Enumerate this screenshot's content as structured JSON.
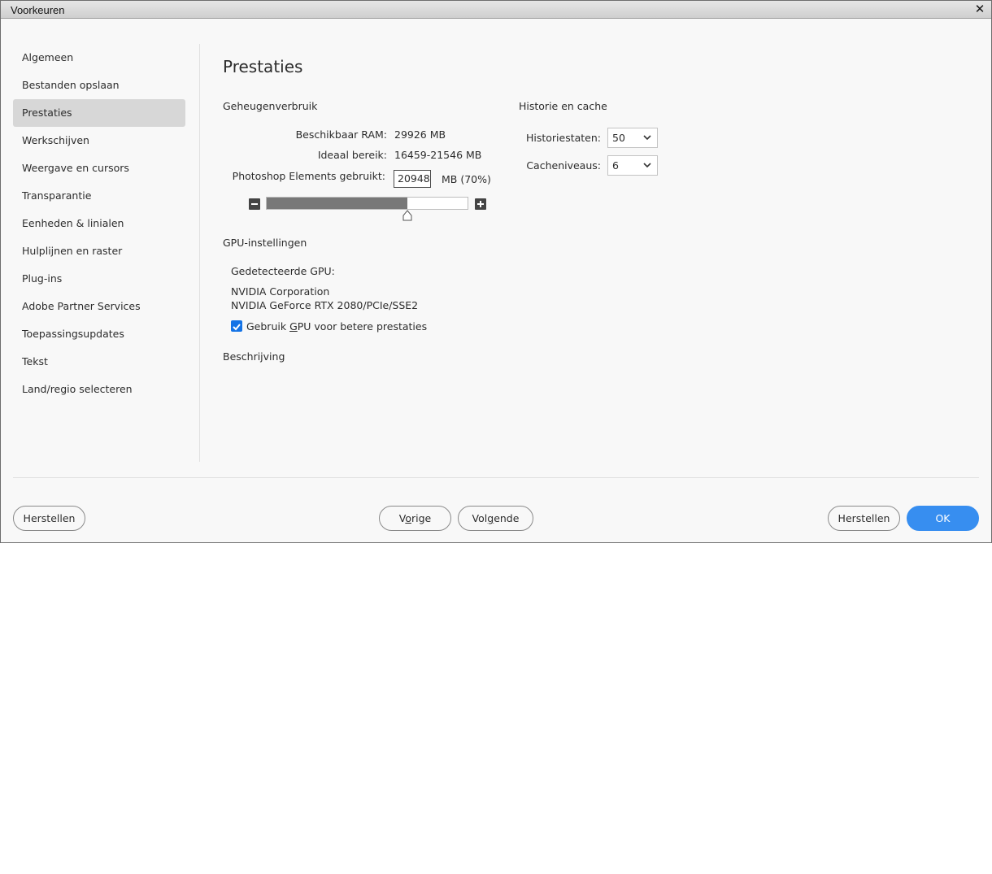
{
  "window": {
    "title": "Voorkeuren",
    "close_icon": "close-icon"
  },
  "sidebar": {
    "items": [
      {
        "label": "Algemeen"
      },
      {
        "label": "Bestanden opslaan"
      },
      {
        "label": "Prestaties",
        "selected": true
      },
      {
        "label": "Werkschijven"
      },
      {
        "label": "Weergave en cursors"
      },
      {
        "label": "Transparantie"
      },
      {
        "label": "Eenheden & linialen"
      },
      {
        "label": "Hulplijnen en raster"
      },
      {
        "label": "Plug-ins"
      },
      {
        "label": "Adobe Partner Services"
      },
      {
        "label": "Toepassingsupdates"
      },
      {
        "label": "Tekst"
      },
      {
        "label": "Land/regio selecteren"
      }
    ]
  },
  "main": {
    "title": "Prestaties",
    "memory": {
      "heading": "Geheugenverbruik",
      "available_label": "Beschikbaar RAM:",
      "available_value": "29926 MB",
      "ideal_label": "Ideaal bereik:",
      "ideal_value": "16459-21546 MB",
      "used_label": "Photoshop Elements gebruikt:",
      "used_value": "20948",
      "used_unit": "MB (70%)",
      "slider_fraction": 0.7
    },
    "history": {
      "heading": "Historie en cache",
      "states_label": "Historiestaten:",
      "states_value": "50",
      "cache_label": "Cacheniveaus:",
      "cache_value": "6"
    },
    "gpu": {
      "heading": "GPU-instellingen",
      "detected_label": "Gedetecteerde GPU:",
      "vendor": "NVIDIA Corporation",
      "model": "NVIDIA GeForce RTX 2080/PCIe/SSE2",
      "use_gpu_label_pre": "Gebruik ",
      "use_gpu_label_accel": "G",
      "use_gpu_label_post": "PU voor betere prestaties",
      "use_gpu_checked": true
    },
    "description_heading": "Beschrijving"
  },
  "footer": {
    "reset_left": "Herstellen",
    "prev_pre": "V",
    "prev_accel": "o",
    "prev_post": "rige",
    "next_pre": "Vol",
    "next_accel": "g",
    "next_post": "ende",
    "reset_right": "Herstellen",
    "ok": "OK"
  },
  "colors": {
    "accent": "#378ef0",
    "checkbox": "#1473e6",
    "selected_bg": "#d7d7d7"
  }
}
